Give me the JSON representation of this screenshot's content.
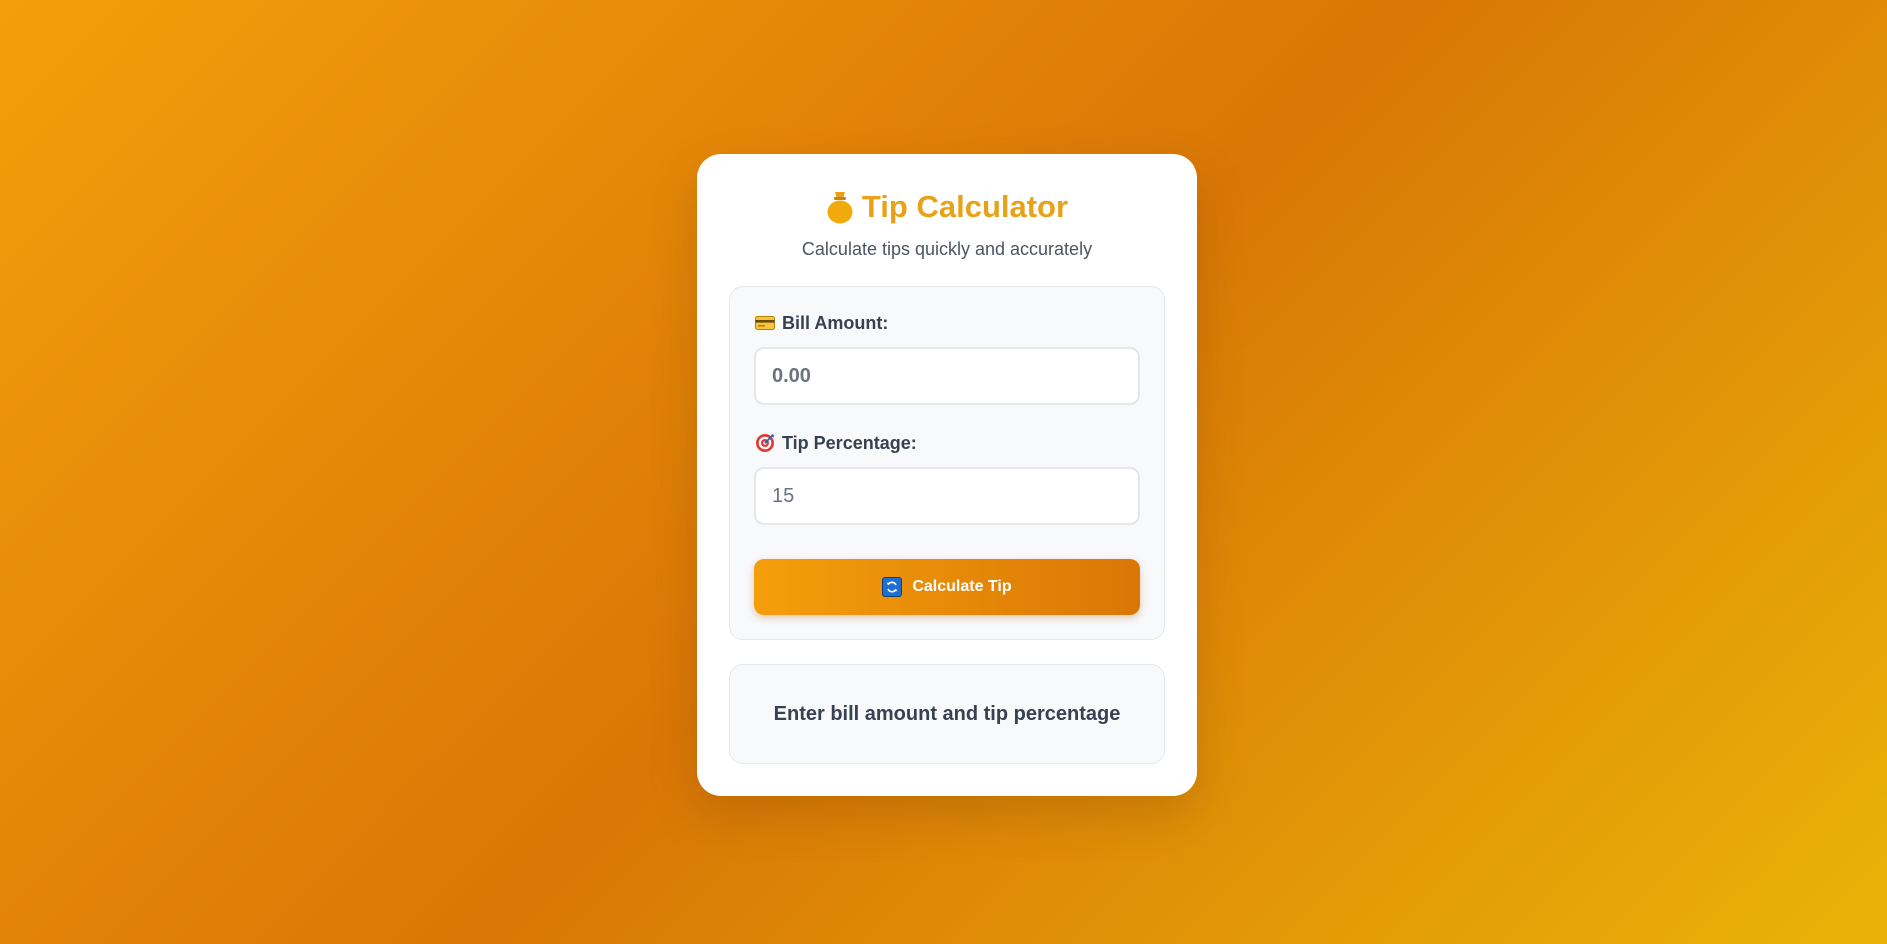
{
  "app": {
    "title": "Tip Calculator",
    "subtitle": "Calculate tips quickly and accurately",
    "title_icon": "money-bag-icon",
    "accent_color": "#e8a21a"
  },
  "form": {
    "bill": {
      "label": "Bill Amount:",
      "icon": "credit-card-icon",
      "value": "",
      "placeholder": "0.00"
    },
    "tip": {
      "label": "Tip Percentage:",
      "icon": "target-icon",
      "value": "15",
      "placeholder": ""
    },
    "calculate_button": {
      "label": "Calculate Tip",
      "icon": "refresh-icon"
    }
  },
  "result": {
    "message": "Enter bill amount and tip percentage"
  }
}
